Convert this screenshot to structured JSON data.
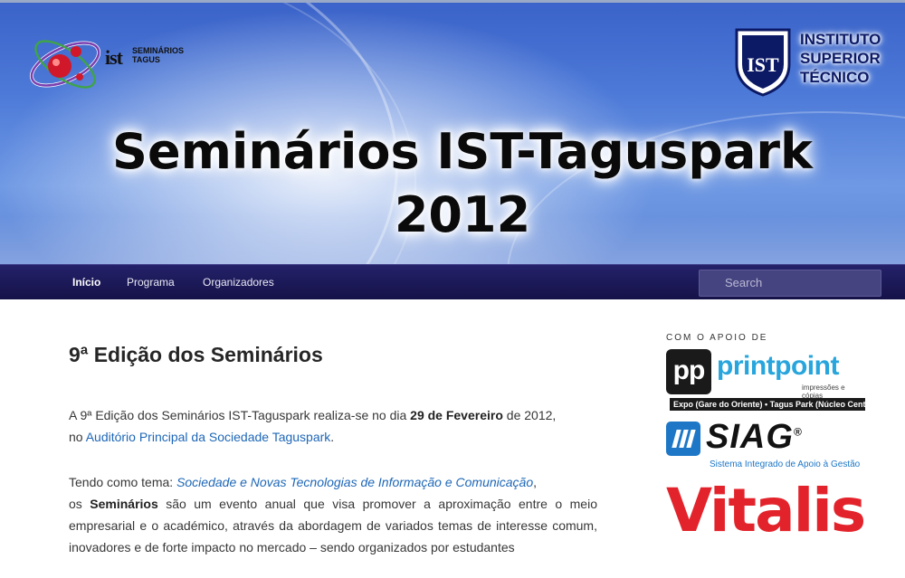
{
  "header": {
    "title_line1": "Seminários IST-Taguspark",
    "title_line2": "2012",
    "logo_left": {
      "ist": "ist",
      "text_line1": "SEMINÁRIOS",
      "text_line2": "TAGUS"
    },
    "logo_right": {
      "line1": "INSTITUTO",
      "line2": "SUPERIOR",
      "line3": "TÉCNICO",
      "shield_text": "IST"
    }
  },
  "nav": {
    "items": [
      {
        "label": "Início",
        "active": true
      },
      {
        "label": "Programa",
        "active": false
      },
      {
        "label": "Organizadores",
        "active": false
      }
    ],
    "search_placeholder": "Search"
  },
  "content": {
    "heading": "9ª Edição dos Seminários",
    "p1": {
      "t1": "A 9ª Edição dos Seminários IST-Taguspark realiza-se no dia ",
      "date": "29 de Fevereiro",
      "t2": " de 2012,",
      "t3": "no ",
      "venue_link": "Auditório Principal da Sociedade Taguspark",
      "t4": "."
    },
    "p2": {
      "t1": "Tendo como tema: ",
      "theme_link": "Sociedade e Novas Tecnologias de Informação e Comunicação",
      "t2": ",",
      "t3": "os ",
      "bold": "Seminários",
      "t4": " são um evento anual que visa promover a aproximação entre o meio empresarial e o académico, através da abordagem de variados temas de interesse comum, inovadores e de forte impacto no mercado – sendo organizados por estudantes"
    }
  },
  "sidebar": {
    "support_label": "COM O APOIO DE",
    "printpoint": {
      "mark": "pp",
      "name": "printpoint",
      "tagline": "impressões e cópias",
      "bar": "Expo (Gare do Oriente) • Tagus Park (Núcleo Central)"
    },
    "siag": {
      "name": "SIAG",
      "reg": "®",
      "tagline": "Sistema Integrado de Apoio à Gestão"
    },
    "vitalis": {
      "name": "Vitalis"
    }
  },
  "colors": {
    "nav_bg": "#1c1a5a",
    "link": "#1e67b7",
    "printpoint_blue": "#27a5dc",
    "siag_blue": "#1d77c6",
    "vitalis_red": "#e3232b"
  }
}
